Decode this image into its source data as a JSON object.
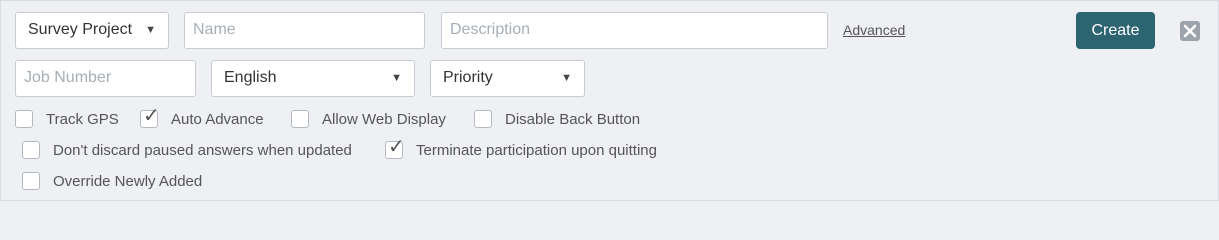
{
  "row1": {
    "type_select": "Survey Project",
    "name_placeholder": "Name",
    "description_placeholder": "Description",
    "advanced_link": "Advanced",
    "create_button": "Create"
  },
  "row2": {
    "job_number_placeholder": "Job Number",
    "language_select": "English",
    "priority_select": "Priority"
  },
  "checkboxes": [
    {
      "label": "Track GPS",
      "checked": false
    },
    {
      "label": "Auto Advance",
      "checked": true
    },
    {
      "label": "Allow Web Display",
      "checked": false
    },
    {
      "label": "Disable Back Button",
      "checked": false
    },
    {
      "label": "Don't discard paused answers when updated",
      "checked": false
    },
    {
      "label": "Terminate participation upon quitting",
      "checked": true
    },
    {
      "label": "Override Newly Added",
      "checked": false
    }
  ],
  "icons": {
    "caret": "▼",
    "check": "✓",
    "close": "close-icon"
  }
}
